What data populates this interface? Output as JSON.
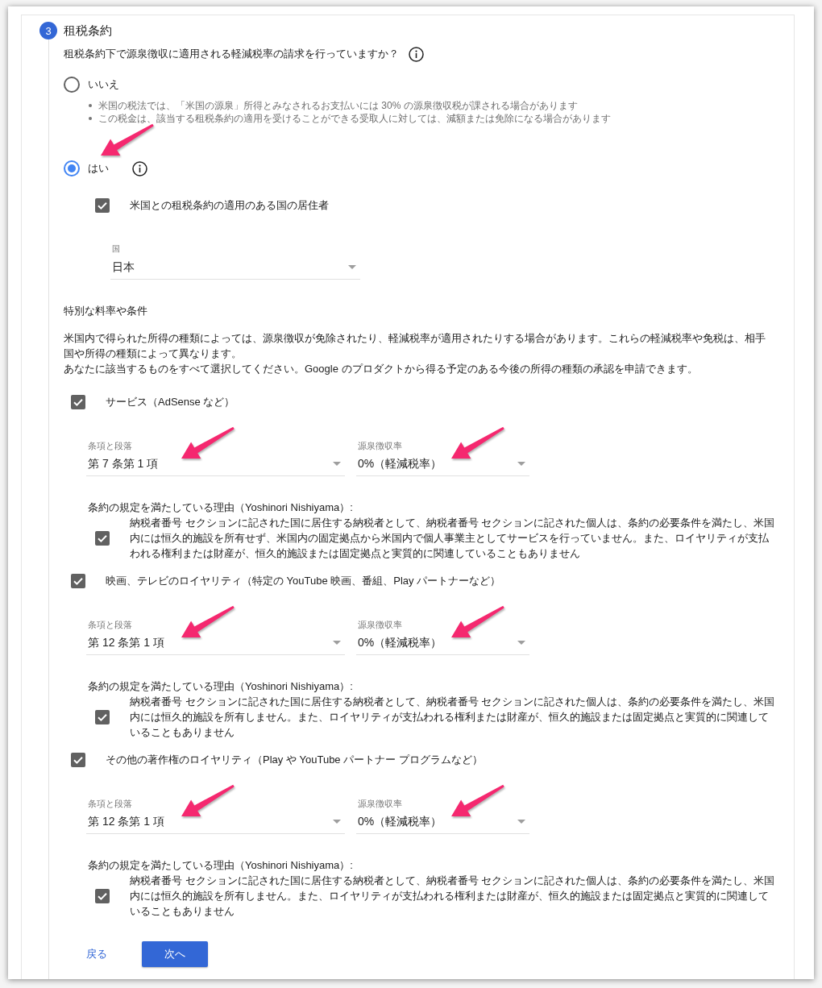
{
  "step": {
    "number": "3",
    "title": "租税条約"
  },
  "question": {
    "text": "租税条約下で源泉徴収に適用される軽減税率の請求を行っていますか？"
  },
  "options": [
    {
      "label": "いいえ",
      "selected": false,
      "info": false,
      "pointer_arrow": false,
      "notes": [
        "米国の税法では、「米国の源泉」所得とみなされるお支払いには 30% の源泉徴収税が課される場合があります",
        "この税金は、該当する租税条約の適用を受けることができる受取人に対しては、減額または免除になる場合があります"
      ]
    },
    {
      "label": "はい",
      "selected": true,
      "info": true,
      "pointer_arrow": true
    }
  ],
  "residency": {
    "label": "米国との租税条約の適用のある国の居住者",
    "checked": true
  },
  "country": {
    "label": "国",
    "value": "日本"
  },
  "special": {
    "heading": "特別な料率や条件",
    "paragraphs": [
      "米国内で得られた所得の種類によっては、源泉徴収が免除されたり、軽減税率が適用されたりする場合があります。これらの軽減税率や免税は、相手国や所得の種類によって異なります。",
      "あなたに該当するものをすべて選択してください。Google のプロダクトから得る予定のある今後の所得の種類の承認を申請できます。"
    ]
  },
  "categories": [
    {
      "label": "サービス（AdSense など）",
      "checked": true,
      "fields": [
        {
          "label": "条項と段落",
          "value": "第 7 条第 1 項",
          "pointer_arrow": true
        },
        {
          "label": "源泉徴収率",
          "value": "0%（軽減税率）",
          "pointer_arrow": true
        }
      ],
      "reason": {
        "label": "条約の規定を満たしている理由（Yoshinori Nishiyama）:",
        "text": "納税者番号 セクションに記された国に居住する納税者として、納税者番号 セクションに記された個人は、条約の必要条件を満たし、米国内には恒久的施設を所有せず、米国内の固定拠点から米国内で個人事業主としてサービスを行っていません。また、ロイヤリティが支払われる権利または財産が、恒久的施設または固定拠点と実質的に関連していることもありません",
        "checked": true
      }
    },
    {
      "label": "映画、テレビのロイヤリティ（特定の YouTube 映画、番組、Play パートナーなど）",
      "checked": true,
      "fields": [
        {
          "label": "条項と段落",
          "value": "第 12 条第 1 項",
          "pointer_arrow": true
        },
        {
          "label": "源泉徴収率",
          "value": "0%（軽減税率）",
          "pointer_arrow": true
        }
      ],
      "reason": {
        "label": "条約の規定を満たしている理由（Yoshinori Nishiyama）:",
        "text": "納税者番号 セクションに記された国に居住する納税者として、納税者番号 セクションに記された個人は、条約の必要条件を満たし、米国内には恒久的施設を所有しません。また、ロイヤリティが支払われる権利または財産が、恒久的施設または固定拠点と実質的に関連していることもありません",
        "checked": true
      }
    },
    {
      "label": "その他の著作権のロイヤリティ（Play や YouTube パートナー プログラムなど）",
      "checked": true,
      "fields": [
        {
          "label": "条項と段落",
          "value": "第 12 条第 1 項",
          "pointer_arrow": true
        },
        {
          "label": "源泉徴収率",
          "value": "0%（軽減税率）",
          "pointer_arrow": true
        }
      ],
      "reason": {
        "label": "条約の規定を満たしている理由（Yoshinori Nishiyama）:",
        "text": "納税者番号 セクションに記された国に居住する納税者として、納税者番号 セクションに記された個人は、条約の必要条件を満たし、米国内には恒久的施設を所有しません。また、ロイヤリティが支払われる権利または財産が、恒久的施設または固定拠点と実質的に関連していることもありません",
        "checked": true
      }
    }
  ],
  "buttons": {
    "back": "戻る",
    "next": "次へ"
  }
}
